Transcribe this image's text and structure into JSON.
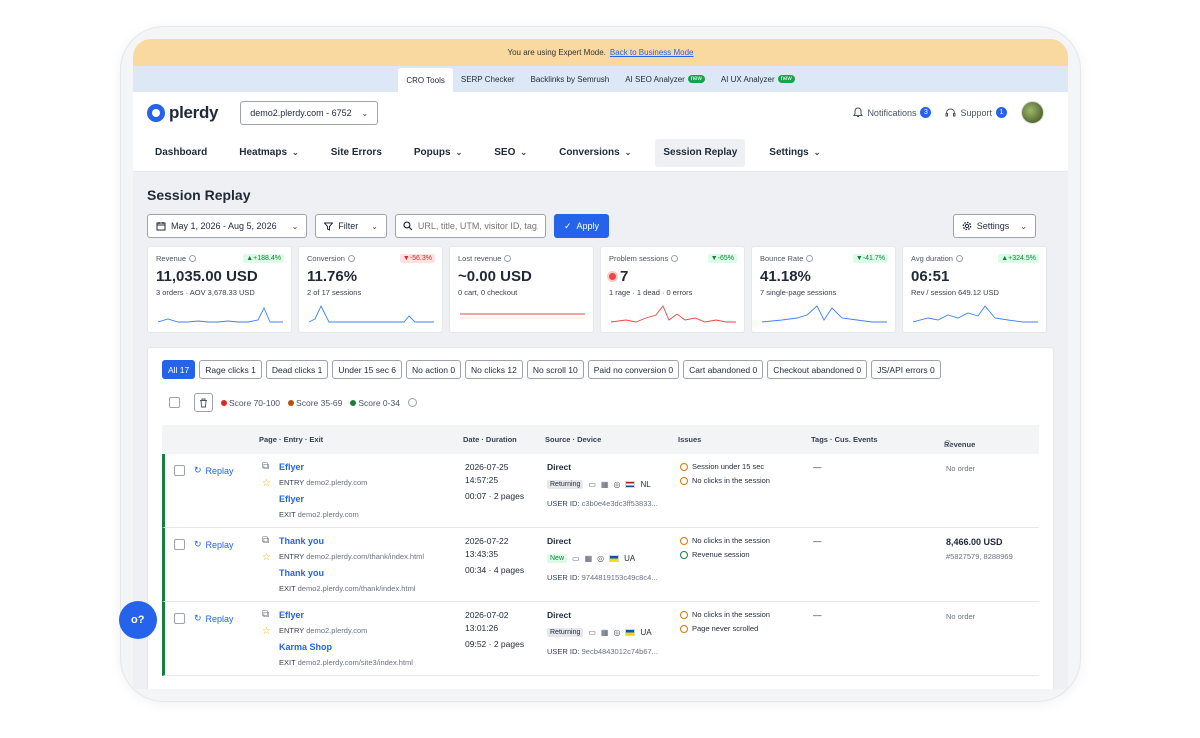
{
  "expert_bar": {
    "text": "You are using Expert Mode.",
    "link": "Back to Business Mode"
  },
  "tools": [
    {
      "label": "CRO Tools",
      "new": ""
    },
    {
      "label": "SERP Checker",
      "new": ""
    },
    {
      "label": "Backlinks by Semrush",
      "new": ""
    },
    {
      "label": "AI SEO Analyzer",
      "new": "new"
    },
    {
      "label": "AI UX Analyzer",
      "new": "new"
    }
  ],
  "header": {
    "logo": "plerdy",
    "site_select": "demo2.plerdy.com - 6752",
    "notifications_label": "Notifications",
    "notifications_count": "3",
    "support_label": "Support",
    "support_count": "1"
  },
  "nav": {
    "dashboard": "Dashboard",
    "heatmaps": "Heatmaps",
    "site_errors": "Site Errors",
    "popups": "Popups",
    "seo": "SEO",
    "conversions": "Conversions",
    "session_replay": "Session Replay",
    "settings": "Settings"
  },
  "page": {
    "title": "Session Replay",
    "date_range": "May 1, 2026 - Aug 5, 2026",
    "filter_label": "Filter",
    "search_placeholder": "URL, title, UTM, visitor ID, tag, e",
    "apply_label": "Apply",
    "settings_label": "Settings"
  },
  "kpis": [
    {
      "label": "Revenue",
      "delta": "+188.4%",
      "value": "11,035.00 USD",
      "sub": "3 orders · AOV 3,678.33 USD"
    },
    {
      "label": "Conversion",
      "delta": "-56.3%",
      "value": "11.76%",
      "sub": "2 of 17 sessions"
    },
    {
      "label": "Lost revenue",
      "delta": "",
      "value": "~0.00 USD",
      "sub": "0 cart, 0 checkout"
    },
    {
      "label": "Problem sessions",
      "delta": "-65%",
      "value": "7",
      "sub": "1 rage · 1 dead · 0 errors"
    },
    {
      "label": "Bounce Rate",
      "delta": "-41.7%",
      "value": "41.18%",
      "sub": "7 single-page sessions"
    },
    {
      "label": "Avg duration",
      "delta": "+324.5%",
      "value": "06:51",
      "sub": "Rev / session 649.12 USD"
    }
  ],
  "colors": {
    "accent": "#2563eb",
    "good": "#15803d",
    "bad": "#dc2626",
    "spark_blue": "#3b82f6",
    "spark_red": "#ef4444"
  },
  "segments": [
    "All 17",
    "Rage clicks 1",
    "Dead clicks 1",
    "Under 15 sec 6",
    "No action 0",
    "No clicks 12",
    "No scroll 10",
    "Paid no conversion 0",
    "Cart abandoned 0",
    "Checkout abandoned 0",
    "JS/API errors 0"
  ],
  "legend": {
    "high": "Score 70-100",
    "mid": "Score 35-69",
    "low": "Score 0-34"
  },
  "table": {
    "columns": {
      "page": "Page · Entry · Exit",
      "date": "Date · Duration",
      "source": "Source · Device",
      "issues": "Issues",
      "tags": "Tags · Cus. Events",
      "revenue": "Revenue"
    },
    "replay_label": "Replay",
    "rows": [
      {
        "title": "Eflyer",
        "entry_label": "ENTRY",
        "entry": "demo2.plerdy.com",
        "exit_title": "Eflyer",
        "exit_label": "EXIT",
        "exit": "demo2.plerdy.com",
        "date": "2026-07-25",
        "time": "14:57:25",
        "duration": "00:07 · 2 pages",
        "source": "Direct",
        "visitor": "Returning",
        "country": "NL",
        "user_label": "USER ID:",
        "user_id": "c3b0e4e3dc3ff53833...",
        "issues": [
          "Session under 15 sec",
          "No clicks in the session"
        ],
        "tags": "—",
        "revenue": "No order",
        "revenue_sub": ""
      },
      {
        "title": "Thank you",
        "entry_label": "ENTRY",
        "entry": "demo2.plerdy.com/thank/index.html",
        "exit_title": "Thank you",
        "exit_label": "EXIT",
        "exit": "demo2.plerdy.com/thank/index.html",
        "date": "2026-07-22",
        "time": "13:43:35",
        "duration": "00:34 · 4 pages",
        "source": "Direct",
        "visitor": "New",
        "country": "UA",
        "user_label": "USER ID:",
        "user_id": "9744819153c49c8c4...",
        "issues": [
          "No clicks in the session",
          "Revenue session"
        ],
        "tags": "—",
        "revenue": "8,466.00 USD",
        "revenue_sub": "#5827579, 8288969"
      },
      {
        "title": "Eflyer",
        "entry_label": "ENTRY",
        "entry": "demo2.plerdy.com",
        "exit_title": "Karma Shop",
        "exit_label": "EXIT",
        "exit": "demo2.plerdy.com/site3/index.html",
        "date": "2026-07-02",
        "time": "13:01:26",
        "duration": "09:52 · 2 pages",
        "source": "Direct",
        "visitor": "Returning",
        "country": "UA",
        "user_label": "USER ID:",
        "user_id": "9ecb4843012c74b67...",
        "issues": [
          "No clicks in the session",
          "Page never scrolled"
        ],
        "tags": "—",
        "revenue": "No order",
        "revenue_sub": ""
      }
    ]
  },
  "help_fab": "o?"
}
